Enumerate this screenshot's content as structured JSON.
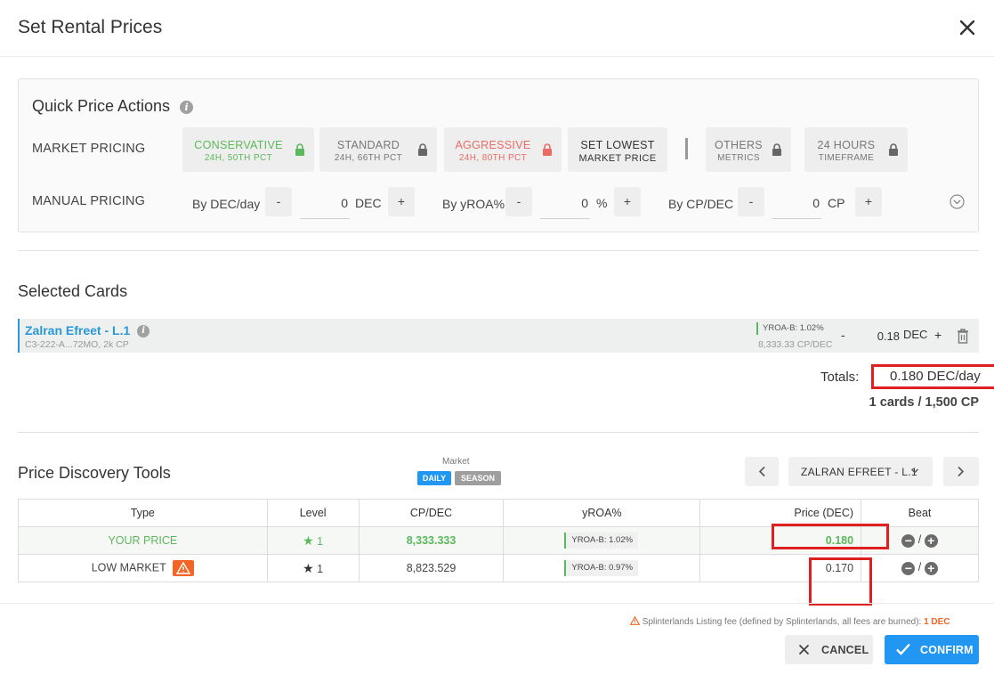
{
  "dialog": {
    "title": "Set Rental Prices"
  },
  "quick_actions": {
    "title": "Quick Price Actions",
    "market_pricing_label": "MARKET PRICING",
    "manual_pricing_label": "MANUAL PRICING",
    "buttons": {
      "conservative": {
        "line1": "CONSERVATIVE",
        "line2": "24H, 50TH PCT",
        "color": "#5cb85c"
      },
      "standard": {
        "line1": "STANDARD",
        "line2": "24H, 66TH PCT"
      },
      "aggressive": {
        "line1": "AGGRESSIVE",
        "line2": "24H, 80TH PCT",
        "color": "#ea6b63"
      },
      "set_lowest": {
        "line1": "SET LOWEST",
        "line2": "MARKET PRICE"
      },
      "others": {
        "line1": "OTHERS",
        "line2": "METRICS"
      },
      "timeframe": {
        "line1": "24 HOURS",
        "line2": "TIMEFRAME"
      }
    },
    "manual": {
      "dec": {
        "label": "By DEC/day",
        "value": "0",
        "unit": "DEC"
      },
      "yroa": {
        "label": "By yROA%",
        "value": "0",
        "unit": "%"
      },
      "cp": {
        "label": "By CP/DEC",
        "value": "0",
        "unit": "CP"
      },
      "minus": "-",
      "plus": "+"
    }
  },
  "selected_cards": {
    "title": "Selected Cards",
    "cards": [
      {
        "name": "Zalran Efreet - L.1",
        "sub": "C3-222-A...72MO, 2k CP",
        "yroa": "YROA-B: 1.02%",
        "cp_dec": "8,333.33 CP/DEC",
        "price": "0.18",
        "unit": "DEC",
        "minus": "-",
        "plus": "+"
      }
    ],
    "totals_label": "Totals:",
    "totals_value": "0.180 DEC/day",
    "cards_count": "1 cards / 1,500 CP"
  },
  "price_discovery": {
    "title": "Price Discovery Tools",
    "market_label": "Market",
    "pills": {
      "daily": "DAILY",
      "season": "SEASON"
    },
    "selected_card": "ZALRAN EFREET - L.1",
    "columns": [
      "Type",
      "Level",
      "CP/DEC",
      "yROA%",
      "Price (DEC)",
      "Beat"
    ],
    "rows": [
      {
        "type": "YOUR PRICE",
        "level": "1",
        "cp_dec": "8,333.333",
        "yroa": "YROA-B: 1.02%",
        "price": "0.180"
      },
      {
        "type": "LOW MARKET",
        "level": "1",
        "cp_dec": "8,823.529",
        "yroa": "YROA-B: 0.97%",
        "price": "0.170"
      }
    ],
    "beat_sep": "/"
  },
  "footer": {
    "fee_note": "Splinterlands Listing fee (defined by Splinterlands, all fees are burned):",
    "fee_value": "1 DEC",
    "cancel": "CANCEL",
    "confirm": "CONFIRM"
  },
  "colors": {
    "accent_blue": "#2196f3",
    "link_blue": "#2a98d7",
    "green": "#5cb85c",
    "red": "#ea6b63",
    "warning_orange": "#f26524",
    "highlight_red": "#e02020"
  },
  "icons": [
    "close-icon",
    "info-icon",
    "lock-icon",
    "chevron-down-circle-icon",
    "trash-icon",
    "chevron-left-icon",
    "chevron-right-icon",
    "chevron-down-icon",
    "star-icon",
    "warning-icon",
    "minus-circle-icon",
    "plus-circle-icon",
    "x-icon",
    "check-icon"
  ]
}
